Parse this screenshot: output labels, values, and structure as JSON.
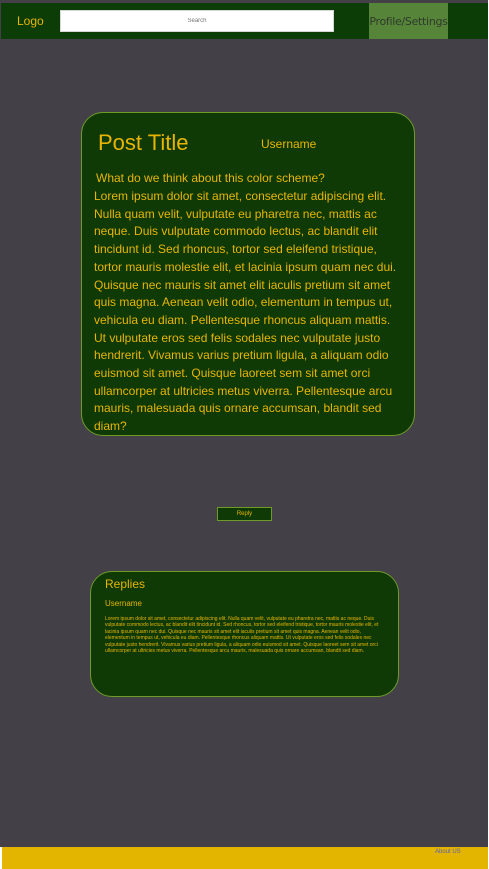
{
  "header": {
    "logo": "Logo",
    "search_placeholder": "Search",
    "profile_label": "Profile/Settings"
  },
  "post": {
    "title": "Post Title",
    "username": "Username",
    "question": "What do we think about this color scheme?",
    "body": "Lorem ipsum dolor sit amet, consectetur adipiscing elit. Nulla quam velit, vulputate eu pharetra nec, mattis ac neque. Duis vulputate commodo lectus, ac blandit elit tincidunt id. Sed rhoncus, tortor sed eleifend tristique, tortor mauris molestie elit, et lacinia ipsum quam nec dui. Quisque nec mauris sit amet elit iaculis pretium sit amet quis magna. Aenean velit odio, elementum in tempus ut, vehicula eu diam. Pellentesque rhoncus aliquam mattis. Ut vulputate eros sed felis sodales nec vulputate justo hendrerit. Vivamus varius pretium ligula, a aliquam odio euismod sit amet. Quisque laoreet sem sit amet orci ullamcorper at ultricies metus viverra. Pellentesque arcu mauris, malesuada quis ornare accumsan, blandit sed diam?"
  },
  "reply_button_label": "Reply",
  "replies": {
    "title": "Replies",
    "items": [
      {
        "username": "Username",
        "body": "Lorem ipsum dolor sit amet, consectetur adipiscing elit. Nulla quam velit, vulputate eu pharetra nec, mattis ac neque. Duis vulputate commodo lectus, ac blandit elit tincidunt id. Sed rhoncus, tortor sed eleifend tristique, tortor mauris molestie elit, et lacinia ipsum quam nec dui. Quisque nec mauris sit amet elit iaculis pretium sit amet quis magna. Aenean velit odio, elementum in tempus ut, vehicula eu diam. Pellentesque rhoncus aliquam mattis. Ut vulputate eros sed felis sodales nec vulputate justo hendrerit. Vivamus varius pretium ligula, a aliquam odio euismod sit amet. Quisque laoreet sem sit amet orci ullamcorper at ultricies metus viverra. Pellentesque arcu mauris, malesuada quis ornare accumsan, blandit sed diam."
      }
    ]
  },
  "footer": {
    "about_label": "About US"
  },
  "colors": {
    "background": "#434147",
    "header": "#0d3d07",
    "card": "#0f3a05",
    "accent_text": "#e8b400",
    "profile_button": "#56853a",
    "footer": "#e3b400"
  }
}
